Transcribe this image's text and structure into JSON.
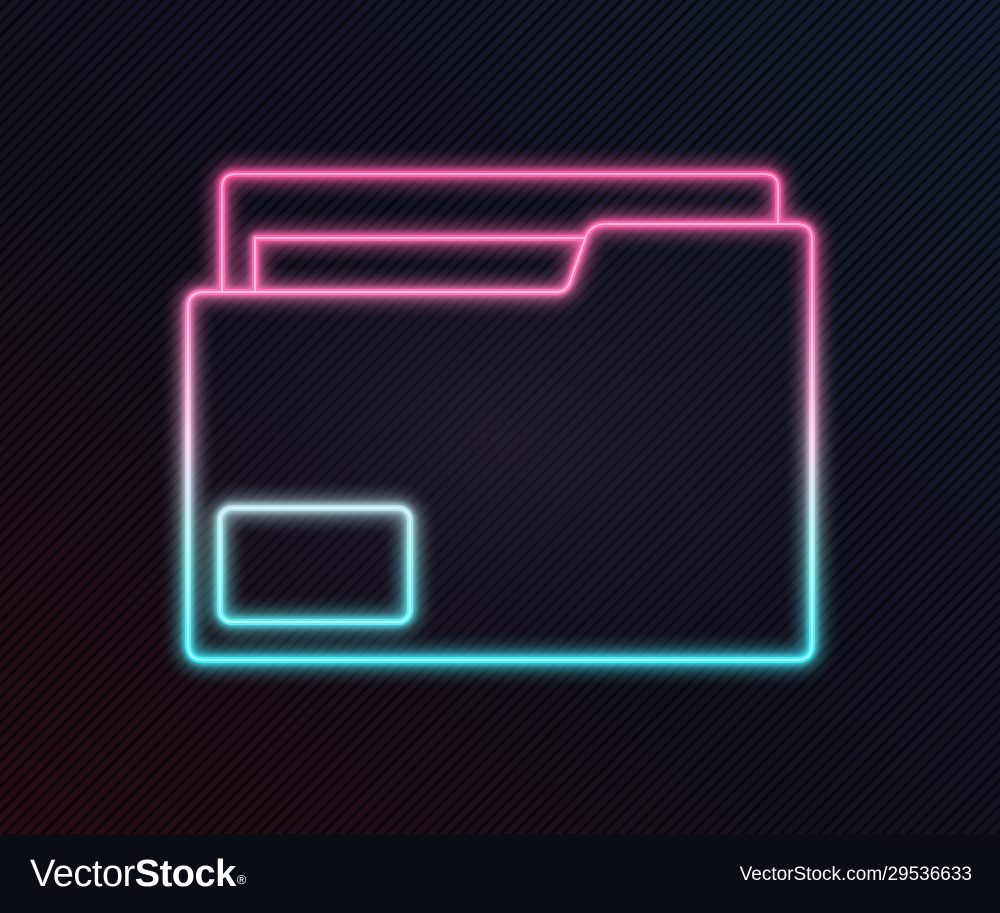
{
  "illustration": {
    "icon": "folder-icon",
    "style": "neon glow line icon",
    "gradient_top_color": "#ff5aa8",
    "gradient_mid_color": "#f2c8e6",
    "gradient_bottom_color": "#3ff0ff",
    "background_colors": [
      "#2a0c13",
      "#15121e",
      "#131c33"
    ]
  },
  "footer": {
    "brand_part1": "Vector",
    "brand_part2": "Stock",
    "brand_mark": "®",
    "image_id": "VectorStock.com/29536633",
    "background_color": "#0b0d14",
    "text_color": "#ffffff"
  }
}
